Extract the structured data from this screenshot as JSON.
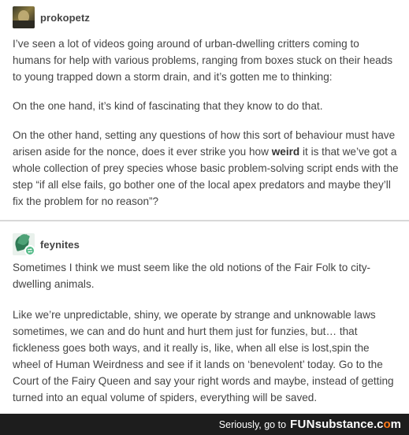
{
  "post1": {
    "username": "prokopetz",
    "paragraphs": [
      "I’ve seen a lot of videos going around of urban-dwelling critters coming to humans for help with various problems, ranging from boxes stuck on their heads to young trapped down a storm drain, and it’s gotten me to thinking:",
      "On the one hand, it’s kind of fascinating that they know to do that."
    ],
    "p3_before": "On the other hand, setting any questions of how this sort of behaviour must have arisen aside for the nonce, does it ever strike you how ",
    "p3_bold": "weird",
    "p3_after": " it is that we’ve got a whole collection of prey species whose basic problem-solving script ends with the step “if all else fails, go bother one of the local apex predators and maybe they’ll fix the problem for no reason”?"
  },
  "post2": {
    "username": "feynites",
    "paragraphs": [
      "Sometimes I think we must seem like the old notions of the Fair Folk to city-dwelling animals.",
      "Like we’re unpredictable, shiny, we operate by strange and unknowable laws sometimes, we can and do hunt and hurt them just for funzies, but… that fickleness goes both ways, and it really is, like, when all else is lost,spin the wheel of Human Weirdness and see if it lands on ‘benevolent’ today. Go to the Court of the Fairy Queen and say your right words and maybe, instead of getting turned into an equal volume of spiders, everything will be saved."
    ]
  },
  "footer": {
    "text": "Seriously, go to",
    "brand_fun": "FUN",
    "brand_substance_pre": "substance",
    "brand_com_pre": ".c",
    "brand_com_o": "o",
    "brand_com_post": "m"
  },
  "icons": {
    "reblog": "reblog-icon",
    "accent": "#56bc8a",
    "footer_bg": "#1d1d1d",
    "brand_dot": "#ff7a1a"
  }
}
